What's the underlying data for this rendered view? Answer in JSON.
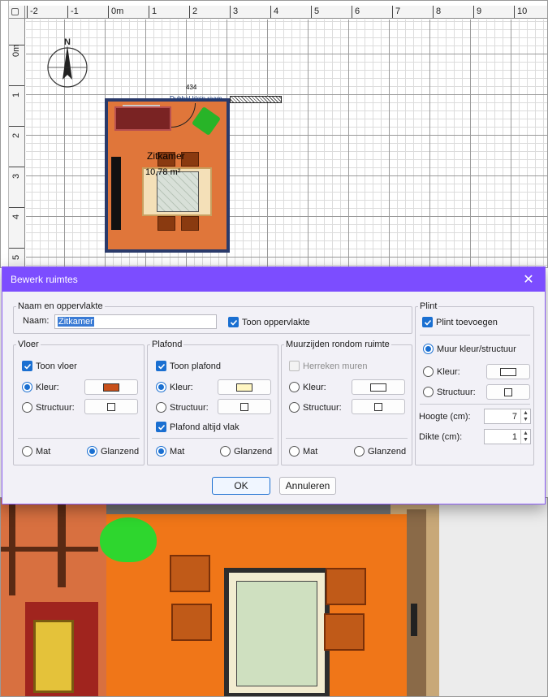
{
  "plan": {
    "ruler_h": [
      "-2",
      "-1",
      "0m",
      "1",
      "2",
      "3",
      "4",
      "5",
      "6",
      "7",
      "8",
      "9",
      "10"
    ],
    "ruler_v": [
      "0m",
      "1",
      "2",
      "3",
      "4",
      "5"
    ],
    "compass_letter": "N",
    "room_name": "Zitkamer",
    "room_area": "10,78 m²",
    "dimension": "434",
    "door_label": "Dubbel klein raam"
  },
  "dialog": {
    "title": "Bewerk ruimtes",
    "close_glyph": "✕",
    "name_group": {
      "legend": "Naam en oppervlakte",
      "name_label": "Naam:",
      "name_value": "Zitkamer",
      "show_area_label": "Toon oppervlakte"
    },
    "floor": {
      "legend": "Vloer",
      "show_label": "Toon vloer",
      "color_label": "Kleur:",
      "texture_label": "Structuur:",
      "color": "#c8501a",
      "mat_label": "Mat",
      "glossy_label": "Glanzend"
    },
    "ceiling": {
      "legend": "Plafond",
      "show_label": "Toon plafond",
      "color_label": "Kleur:",
      "texture_label": "Structuur:",
      "color": "#fff6c2",
      "flat_label": "Plafond altijd vlak",
      "mat_label": "Mat",
      "glossy_label": "Glanzend"
    },
    "walls": {
      "legend": "Muurzijden rondom ruimte",
      "recalc_label": "Herreken muren",
      "color_label": "Kleur:",
      "texture_label": "Structuur:",
      "color": "#ffffff",
      "mat_label": "Mat",
      "glossy_label": "Glanzend"
    },
    "baseboard": {
      "legend": "Plint",
      "add_label": "Plint toevoegen",
      "wall_color_label": "Muur kleur/structuur",
      "color_label": "Kleur:",
      "texture_label": "Structuur:",
      "color": "#ffffff",
      "height_label": "Hoogte (cm):",
      "height_value": "7",
      "thickness_label": "Dikte (cm):",
      "thickness_value": "1"
    },
    "ok_label": "OK",
    "cancel_label": "Annuleren"
  }
}
